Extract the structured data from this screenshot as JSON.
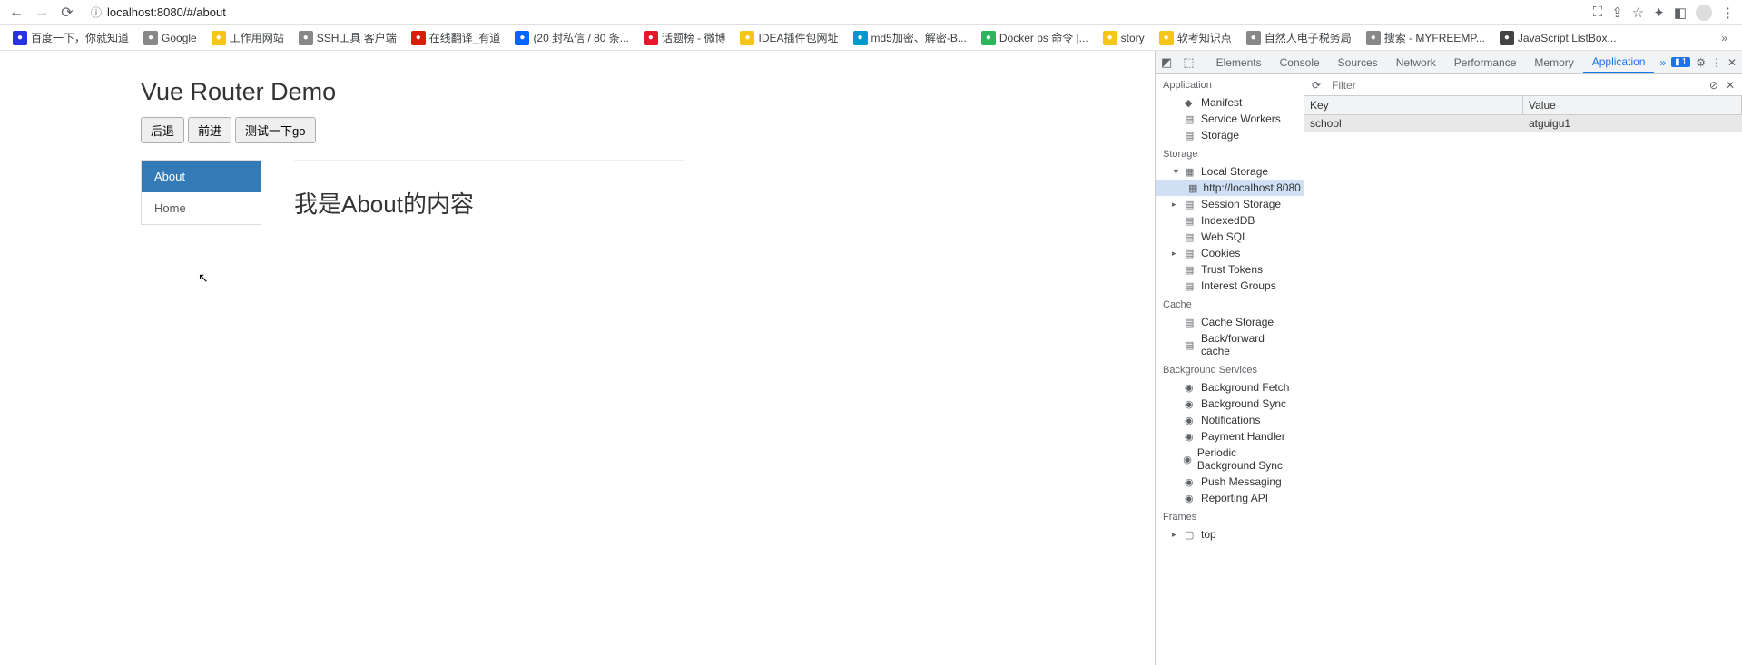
{
  "url": "localhost:8080/#/about",
  "bookmarks": [
    {
      "label": "百度一下，你就知道",
      "color": "#2932e1"
    },
    {
      "label": "Google",
      "color": "#888"
    },
    {
      "label": "工作用网站",
      "color": "#f5c518"
    },
    {
      "label": "SSH工具 客户端",
      "color": "#888"
    },
    {
      "label": "在线翻译_有道",
      "color": "#d81e06"
    },
    {
      "label": "(20 封私信 / 80 条...",
      "color": "#0066ff"
    },
    {
      "label": "话题榜 - 微博",
      "color": "#e6162d"
    },
    {
      "label": "IDEA插件包网址",
      "color": "#f5c518"
    },
    {
      "label": "md5加密、解密-B...",
      "color": "#0099cc"
    },
    {
      "label": "Docker ps 命令 |...",
      "color": "#2db55d"
    },
    {
      "label": "story",
      "color": "#f5c518"
    },
    {
      "label": "软考知识点",
      "color": "#f5c518"
    },
    {
      "label": "自然人电子税务局",
      "color": "#888"
    },
    {
      "label": "搜索 - MYFREEMP...",
      "color": "#888"
    },
    {
      "label": "JavaScript ListBox...",
      "color": "#444"
    }
  ],
  "page": {
    "title": "Vue Router Demo",
    "buttons": [
      "后退",
      "前进",
      "测试一下go"
    ],
    "nav": [
      {
        "label": "About",
        "active": true
      },
      {
        "label": "Home",
        "active": false
      }
    ],
    "heading": "我是About的内容"
  },
  "devtools": {
    "tabs": [
      "Elements",
      "Console",
      "Sources",
      "Network",
      "Performance",
      "Memory",
      "Application"
    ],
    "activeTab": "Application",
    "msgCount": "1",
    "filterPlaceholder": "Filter",
    "sidebar": {
      "application": {
        "title": "Application",
        "items": [
          "Manifest",
          "Service Workers",
          "Storage"
        ]
      },
      "storage": {
        "title": "Storage",
        "localStorage": {
          "label": "Local Storage",
          "origin": "http://localhost:8080"
        },
        "items": [
          "Session Storage",
          "IndexedDB",
          "Web SQL",
          "Cookies",
          "Trust Tokens",
          "Interest Groups"
        ]
      },
      "cache": {
        "title": "Cache",
        "items": [
          "Cache Storage",
          "Back/forward cache"
        ]
      },
      "bgservices": {
        "title": "Background Services",
        "items": [
          "Background Fetch",
          "Background Sync",
          "Notifications",
          "Payment Handler",
          "Periodic Background Sync",
          "Push Messaging",
          "Reporting API"
        ]
      },
      "frames": {
        "title": "Frames",
        "top": "top"
      }
    },
    "table": {
      "headers": [
        "Key",
        "Value"
      ],
      "rows": [
        {
          "key": "school",
          "value": "atguigu1"
        }
      ]
    }
  }
}
